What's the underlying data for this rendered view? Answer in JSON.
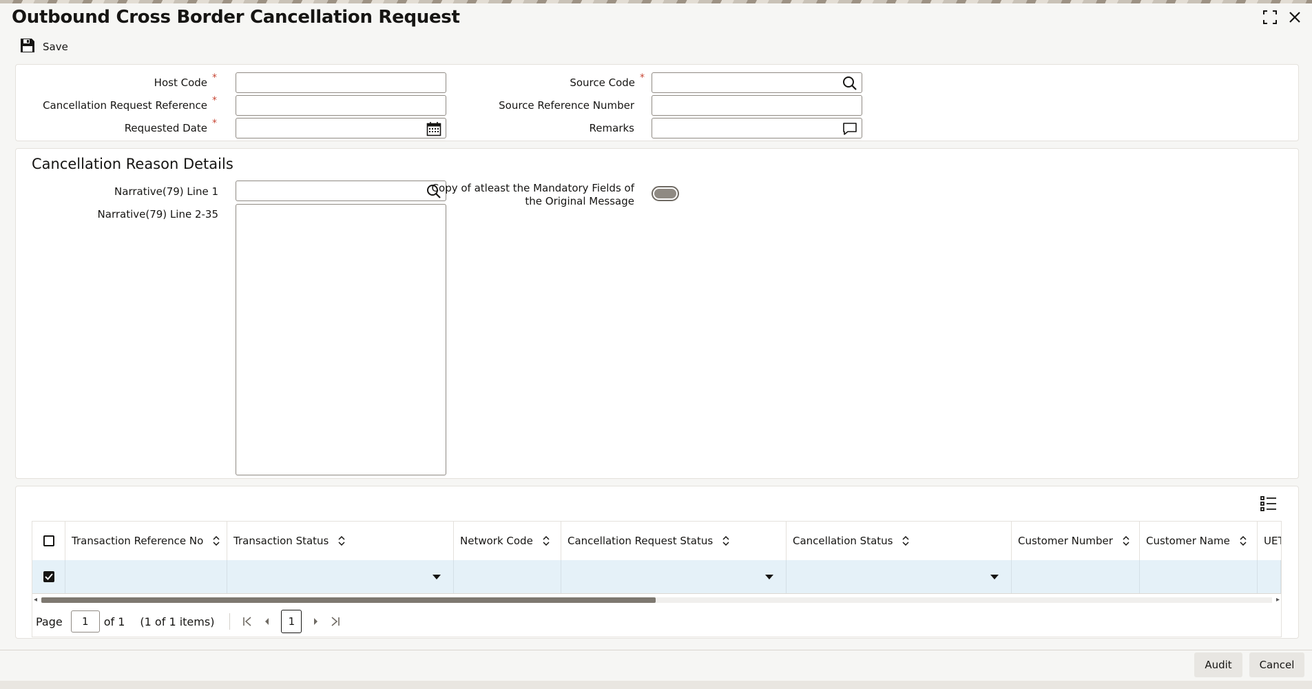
{
  "window": {
    "title": "Outbound Cross Border Cancellation Request",
    "maximize_icon": "maximize-icon",
    "close_icon": "close-icon"
  },
  "toolbar": {
    "save_label": "Save"
  },
  "header_form": {
    "host_code_label": "Host Code",
    "host_code_value": "",
    "cancel_ref_label": "Cancellation Request Reference",
    "cancel_ref_value": "",
    "requested_date_label": "Requested Date",
    "requested_date_value": "",
    "source_code_label": "Source Code",
    "source_code_value": "",
    "source_ref_label": "Source Reference Number",
    "source_ref_value": "",
    "remarks_label": "Remarks",
    "remarks_value": "",
    "required_mark": "*"
  },
  "reason_section": {
    "title": "Cancellation Reason Details",
    "narrative_line1_label": "Narrative(79) Line 1",
    "narrative_line1_value": "",
    "narrative_lines_label": "Narrative(79) Line 2-35",
    "narrative_lines_value": "",
    "copy_fields_label_line1": "Copy of atleast the Mandatory Fields of",
    "copy_fields_label_line2": "the Original Message",
    "copy_fields_enabled": false
  },
  "grid": {
    "columns": [
      "Transaction Reference No",
      "Transaction Status",
      "Network Code",
      "Cancellation Request Status",
      "Cancellation Status",
      "Customer Number",
      "Customer Name",
      "UET"
    ],
    "rows": [
      {
        "selected": true,
        "cells": [
          "",
          "",
          "",
          "",
          "",
          "",
          "",
          ""
        ]
      }
    ],
    "column_settings_icon": "list-settings-icon"
  },
  "pager": {
    "page_label": "Page",
    "page_value": "1",
    "of_label": "of 1",
    "items_label": "(1 of 1 items)",
    "current_page": "1"
  },
  "footer": {
    "audit_label": "Audit",
    "cancel_label": "Cancel"
  },
  "colors": {
    "required": "#c74634",
    "row_selected": "#e5f1f8",
    "text": "#161513"
  }
}
